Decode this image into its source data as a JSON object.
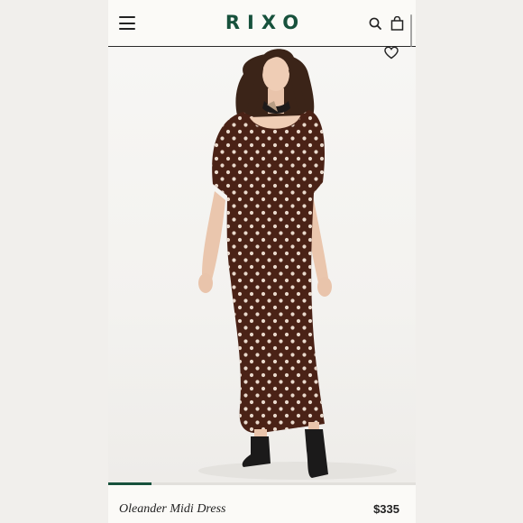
{
  "header": {
    "logo": "RIXO",
    "menu_icon": "hamburger-menu-icon",
    "search_icon": "search-icon",
    "bag_icon": "shopping-bag-icon"
  },
  "gallery": {
    "wishlist_icon": "heart-icon",
    "image_position": 1,
    "image_progress": 0.14,
    "dress_color": "#4a2216",
    "dot_color": "#e9d9cc"
  },
  "product": {
    "name": "Oleander Midi Dress",
    "price": "$335"
  },
  "colors": {
    "brand": "#17513c",
    "background": "#fbfaf7",
    "text": "#222222"
  }
}
